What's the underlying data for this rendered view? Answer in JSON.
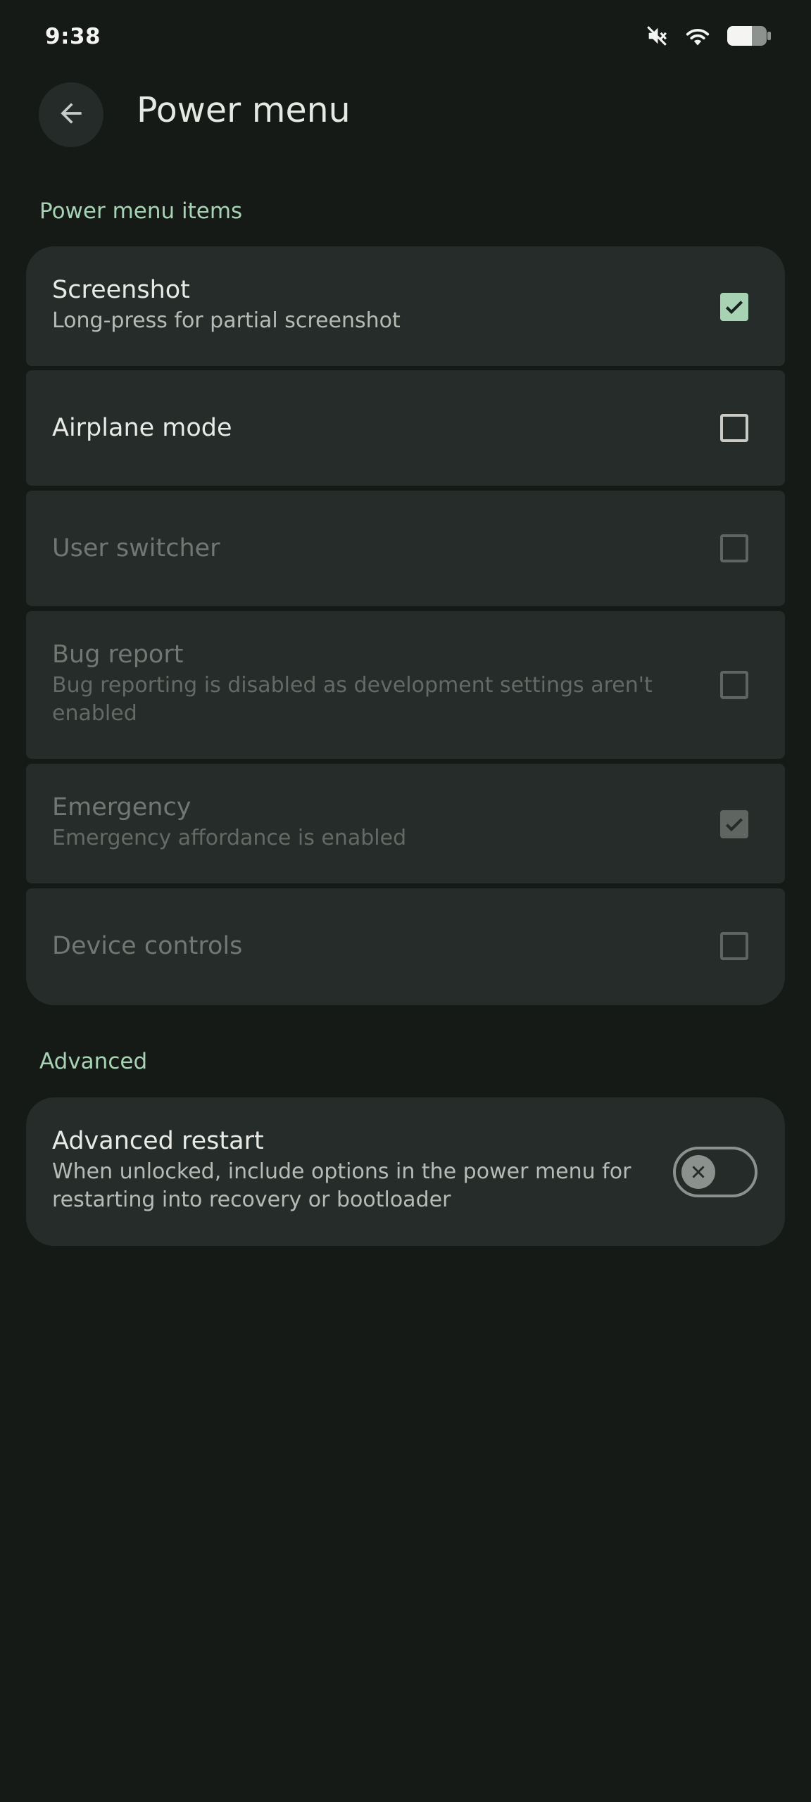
{
  "status_bar": {
    "time": "9:38",
    "icons": [
      "mute-icon",
      "wifi-icon",
      "battery-icon"
    ]
  },
  "header": {
    "back_icon": "arrow-back-icon",
    "title": "Power menu"
  },
  "sections": {
    "power_menu_items": {
      "header": "Power menu items",
      "items": [
        {
          "title": "Screenshot",
          "subtitle": "Long-press for partial screenshot",
          "checked": true,
          "enabled": true
        },
        {
          "title": "Airplane mode",
          "subtitle": "",
          "checked": false,
          "enabled": true
        },
        {
          "title": "User switcher",
          "subtitle": "",
          "checked": false,
          "enabled": false
        },
        {
          "title": "Bug report",
          "subtitle": "Bug reporting is disabled as development settings aren't enabled",
          "checked": false,
          "enabled": false
        },
        {
          "title": "Emergency",
          "subtitle": "Emergency affordance is enabled",
          "checked": true,
          "enabled": false
        },
        {
          "title": "Device controls",
          "subtitle": "",
          "checked": false,
          "enabled": false
        }
      ]
    },
    "advanced": {
      "header": "Advanced",
      "items": [
        {
          "title": "Advanced restart",
          "subtitle": "When unlocked, include options in the power menu for restarting into recovery or bootloader",
          "toggle_on": false
        }
      ]
    }
  },
  "colors": {
    "background": "#151a17",
    "card": "#252c29",
    "accent": "#a7d3b4"
  }
}
